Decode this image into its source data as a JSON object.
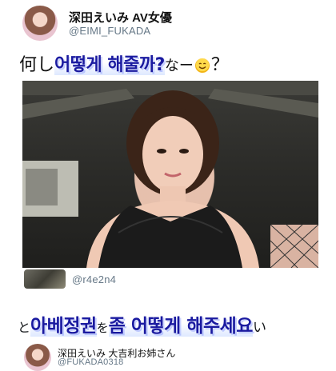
{
  "tweet1": {
    "display_name": "深田えいみ AV女優",
    "handle": "@EIMI_FUKADA",
    "text_pre": "何し",
    "text_overlay": "어떻게 해줄까?",
    "text_post": "なー",
    "text_end": "？"
  },
  "reply1": {
    "handle": "@r4e2n4",
    "text_pre": "と",
    "text_overlay": "아베정권",
    "text_mid": "を",
    "text_overlay2": "좀 어떻게 해주세요",
    "text_post": "い"
  },
  "reply2": {
    "display_name": "深田えいみ 大吉利お姉さん",
    "handle": "@FUKADA0318"
  },
  "icons": [
    "profile-avatar",
    "smile-emoji",
    "photo"
  ]
}
